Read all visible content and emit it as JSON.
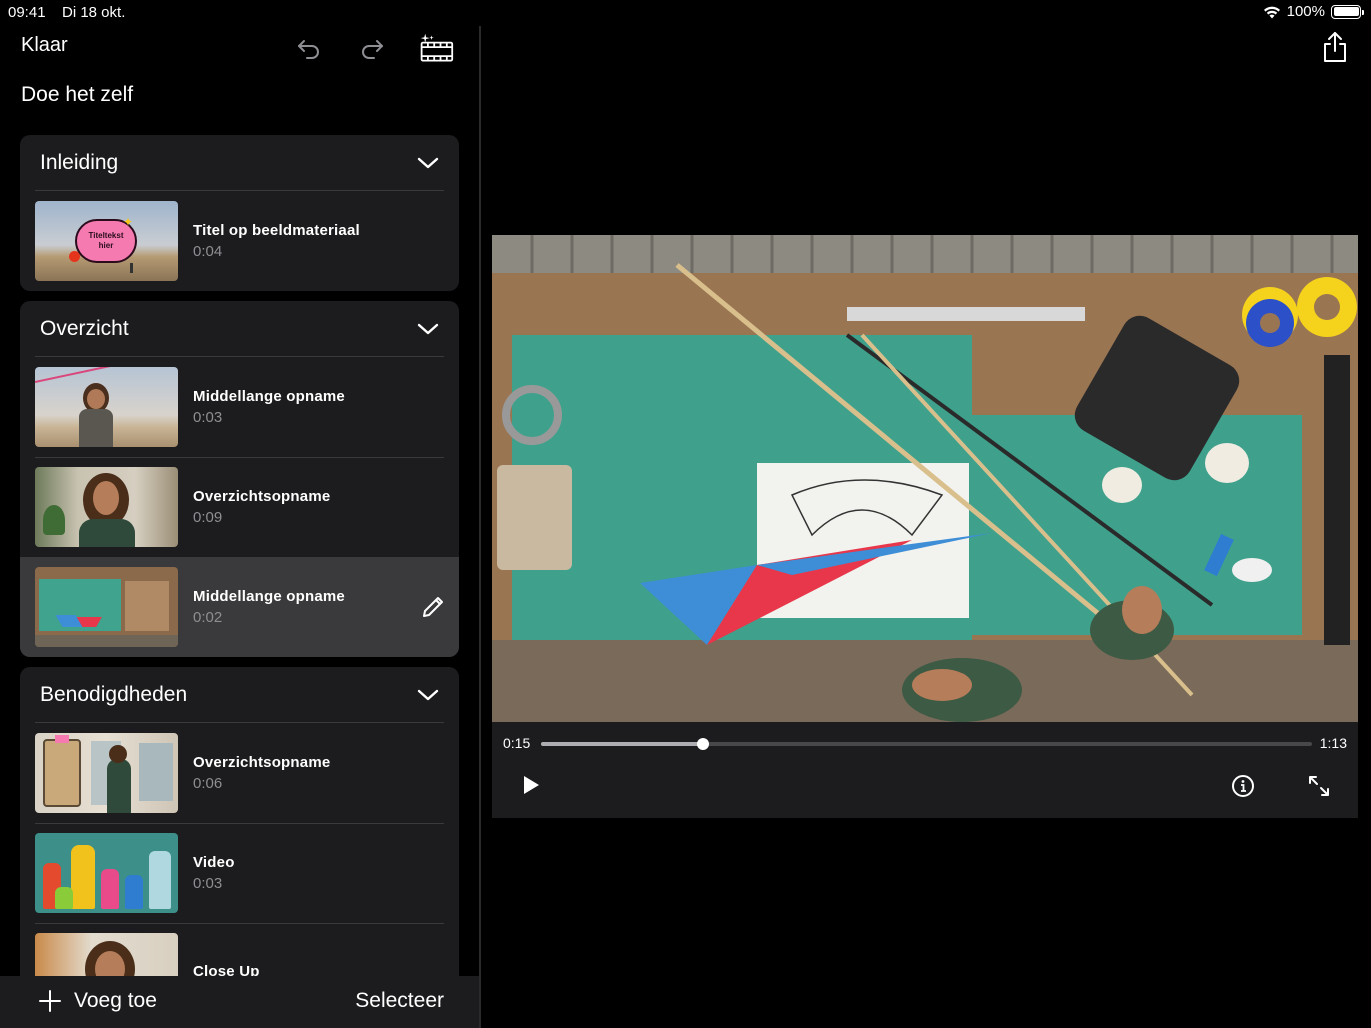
{
  "status": {
    "time": "09:41",
    "date": "Di 18 okt.",
    "battery": "100%"
  },
  "toolbar": {
    "done_label": "Klaar",
    "icons": [
      "undo-icon",
      "redo-icon",
      "magic-movie-icon"
    ]
  },
  "page_title": "Doe het zelf",
  "sections": [
    {
      "title": "Inleiding",
      "clips": [
        {
          "title": "Titel op beeldmateriaal",
          "duration": "0:04",
          "thumb_text": "Titeltekst hier"
        }
      ]
    },
    {
      "title": "Overzicht",
      "clips": [
        {
          "title": "Middellange opname",
          "duration": "0:03"
        },
        {
          "title": "Overzichtsopname",
          "duration": "0:09"
        },
        {
          "title": "Middellange opname",
          "duration": "0:02",
          "selected": true
        }
      ]
    },
    {
      "title": "Benodigdheden",
      "clips": [
        {
          "title": "Overzichtsopname",
          "duration": "0:06"
        },
        {
          "title": "Video",
          "duration": "0:03"
        },
        {
          "title": "Close Up",
          "duration": ""
        }
      ]
    }
  ],
  "bottom": {
    "add_label": "Voeg toe",
    "select_label": "Selecteer"
  },
  "player": {
    "current_time": "0:15",
    "total_time": "1:13",
    "progress": 0.21
  },
  "colors": {
    "panel": "#1c1c1e",
    "selected": "#3a3a3c",
    "secondary_text": "#8e8e93"
  }
}
